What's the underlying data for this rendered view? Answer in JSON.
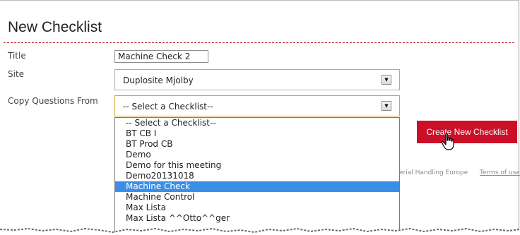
{
  "page": {
    "heading": "New Checklist"
  },
  "form": {
    "title_label": "Title",
    "title_value": "Machine Check 2",
    "site_label": "Site",
    "site_value": "Duplosite Mjolby",
    "copy_label": "Copy Questions From",
    "copy_value": "-- Select a Checklist--"
  },
  "dropdown": {
    "options": [
      "-- Select a Checklist--",
      "BT CB I",
      "BT Prod CB",
      "Demo",
      "Demo for this meeting",
      "Demo20131018",
      "Machine Check",
      "Machine Control",
      "Max Lista",
      "Max Lista ^^Otto^^ger"
    ],
    "highlighted_index": 6
  },
  "actions": {
    "create_label": "Create New Checklist"
  },
  "footer": {
    "company_fragment": "erial Handling Europe",
    "terms_label": "Terms of use"
  },
  "colors": {
    "accent": "#cc0f29",
    "highlight": "#3b8ee6",
    "focus_border": "#d9a23a"
  },
  "icons": {
    "select_arrow": "chevron-down-icon",
    "cursor": "hand-pointer-icon"
  }
}
